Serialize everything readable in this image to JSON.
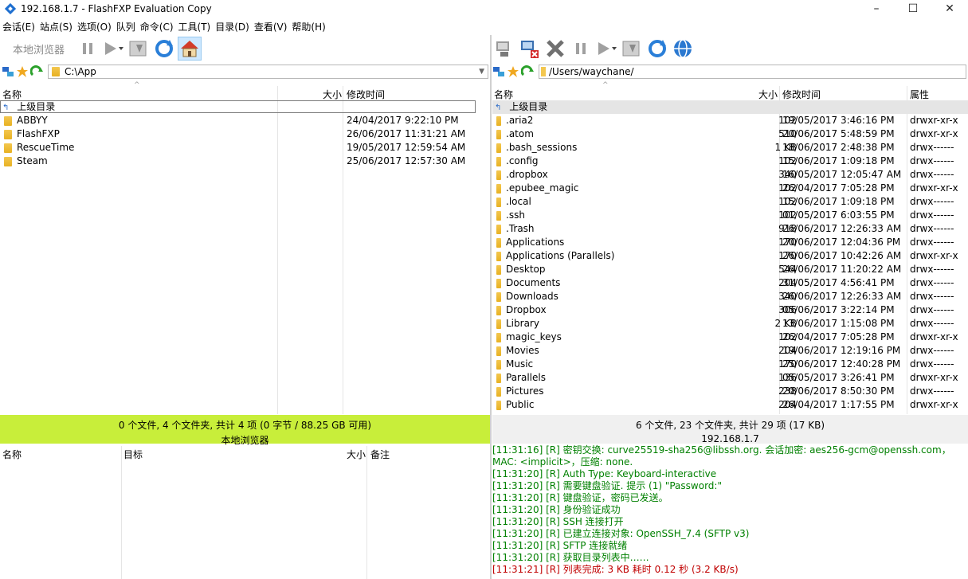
{
  "window": {
    "title": "192.168.1.7 - FlashFXP Evaluation Copy",
    "controls": [
      "–",
      "☐",
      "✕"
    ]
  },
  "menu": [
    "会话(E)",
    "站点(S)",
    "选项(O)",
    "队列",
    "命令(C)",
    "工具(T)",
    "目录(D)",
    "查看(V)",
    "帮助(H)"
  ],
  "left": {
    "toolbar_label": "本地浏览器",
    "path": "C:\\App",
    "columns": {
      "name": "名称",
      "size": "大小",
      "modified": "修改时间"
    },
    "parent_label": "上级目录",
    "rows": [
      {
        "name": "ABBYY",
        "modified": "24/04/2017 9:22:10 PM"
      },
      {
        "name": "FlashFXP",
        "modified": "26/06/2017 11:31:21 AM"
      },
      {
        "name": "RescueTime",
        "modified": "19/05/2017 12:59:54 AM"
      },
      {
        "name": "Steam",
        "modified": "25/06/2017 12:57:30 AM"
      }
    ],
    "status_line1": "0 个文件, 4 个文件夹, 共计 4 项 (0 字节 / 88.25 GB 可用)",
    "status_line2": "本地浏览器"
  },
  "right": {
    "path": "/Users/waychane/",
    "columns": {
      "name": "名称",
      "size": "大小",
      "modified": "修改时间",
      "attr": "属性"
    },
    "parent_label": "上级目录",
    "rows": [
      {
        "name": ".aria2",
        "size": "102",
        "modified": "19/05/2017 3:46:16 PM",
        "attr": "drwxr-xr-x"
      },
      {
        "name": ".atom",
        "size": "510",
        "modified": "20/06/2017 5:48:59 PM",
        "attr": "drwxr-xr-x"
      },
      {
        "name": ".bash_sessions",
        "size": "1 KB",
        "modified": "18/06/2017 2:48:38 PM",
        "attr": "drwx------"
      },
      {
        "name": ".config",
        "size": "102",
        "modified": "15/06/2017 1:09:18 PM",
        "attr": "drwx------"
      },
      {
        "name": ".dropbox",
        "size": "340",
        "modified": "16/05/2017 12:05:47 AM",
        "attr": "drwx------"
      },
      {
        "name": ".epubee_magic",
        "size": "102",
        "modified": "26/04/2017 7:05:28 PM",
        "attr": "drwxr-xr-x"
      },
      {
        "name": ".local",
        "size": "102",
        "modified": "15/06/2017 1:09:18 PM",
        "attr": "drwx------"
      },
      {
        "name": ".ssh",
        "size": "102",
        "modified": "01/05/2017 6:03:55 PM",
        "attr": "drwx------"
      },
      {
        "name": ".Trash",
        "size": "918",
        "modified": "26/06/2017 12:26:33 AM",
        "attr": "drwx------"
      },
      {
        "name": "Applications",
        "size": "170",
        "modified": "20/06/2017 12:04:36 PM",
        "attr": "drwx------"
      },
      {
        "name": "Applications (Parallels)",
        "size": "170",
        "modified": "26/06/2017 10:42:26 AM",
        "attr": "drwxr-xr-x"
      },
      {
        "name": "Desktop",
        "size": "544",
        "modified": "26/06/2017 11:20:22 AM",
        "attr": "drwx------"
      },
      {
        "name": "Documents",
        "size": "204",
        "modified": "31/05/2017 4:56:41 PM",
        "attr": "drwx------"
      },
      {
        "name": "Downloads",
        "size": "340",
        "modified": "26/06/2017 12:26:33 AM",
        "attr": "drwx------"
      },
      {
        "name": "Dropbox",
        "size": "306",
        "modified": "05/06/2017 3:22:14 PM",
        "attr": "drwx------"
      },
      {
        "name": "Library",
        "size": "2 KB",
        "modified": "13/06/2017 1:15:08 PM",
        "attr": "drwx------"
      },
      {
        "name": "magic_keys",
        "size": "102",
        "modified": "26/04/2017 7:05:28 PM",
        "attr": "drwxr-xr-x"
      },
      {
        "name": "Movies",
        "size": "204",
        "modified": "19/06/2017 12:19:16 PM",
        "attr": "drwx------"
      },
      {
        "name": "Music",
        "size": "170",
        "modified": "25/06/2017 12:40:28 PM",
        "attr": "drwx------"
      },
      {
        "name": "Parallels",
        "size": "136",
        "modified": "05/05/2017 3:26:41 PM",
        "attr": "drwxr-xr-x"
      },
      {
        "name": "Pictures",
        "size": "238",
        "modified": "20/06/2017 8:50:30 PM",
        "attr": "drwx------"
      },
      {
        "name": "Public",
        "size": "204",
        "modified": "26/04/2017 1:17:55 PM",
        "attr": "drwxr-xr-x"
      }
    ],
    "status_line1": "6 个文件, 23 个文件夹, 共计 29 项 (17 KB)",
    "status_line2": "192.168.1.7"
  },
  "queue": {
    "columns": {
      "name": "名称",
      "target": "目标",
      "size": "大小",
      "note": "备注"
    }
  },
  "log": [
    {
      "text": "[11:31:16] [R] 密钥交换: curve25519-sha256@libssh.org. 会话加密: aes256-gcm@openssh.com，MAC: <implicit>，压缩: none.",
      "color": "green"
    },
    {
      "text": "[11:31:20] [R] Auth Type: Keyboard-interactive",
      "color": "green"
    },
    {
      "text": "[11:31:20] [R] 需要键盘验证. 提示 (1) \"Password:\"",
      "color": "green"
    },
    {
      "text": "[11:31:20] [R] 键盘验证，密码已发送。",
      "color": "green"
    },
    {
      "text": "[11:31:20] [R] 身份验证成功",
      "color": "green"
    },
    {
      "text": "[11:31:20] [R] SSH 连接打开",
      "color": "green"
    },
    {
      "text": "[11:31:20] [R] 已建立连接对象: OpenSSH_7.4 (SFTP v3)",
      "color": "green"
    },
    {
      "text": "[11:31:20] [R] SFTP 连接就绪",
      "color": "green"
    },
    {
      "text": "[11:31:20] [R] 获取目录列表中……",
      "color": "green"
    },
    {
      "text": "[11:31:21] [R] 列表完成: 3 KB 耗时 0.12 秒 (3.2 KB/s)",
      "color": "red"
    }
  ],
  "colors": {
    "left_status_bg": "#c8ee3a",
    "right_status_bg": "#f0f0f0",
    "log_green": "#008000",
    "log_red": "#c00000",
    "selection": "#e5e5e5"
  }
}
